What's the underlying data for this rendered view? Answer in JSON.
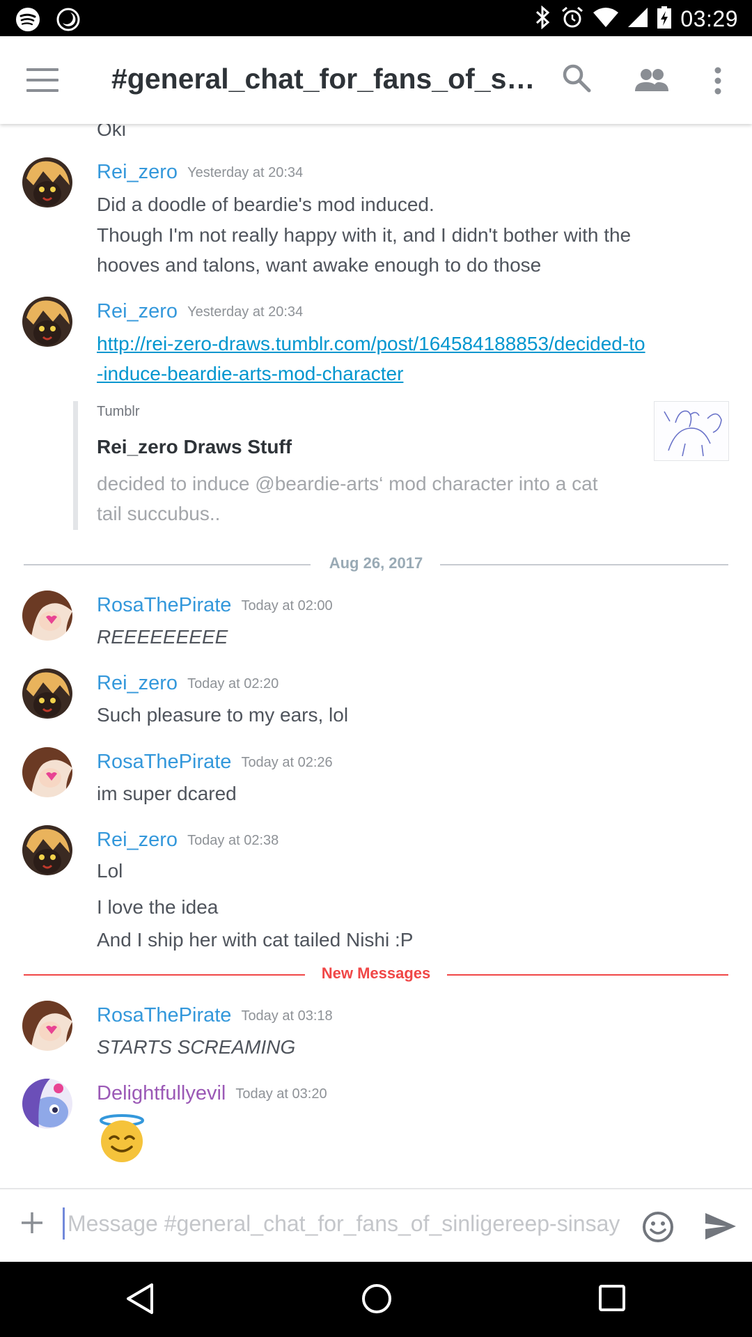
{
  "status_bar": {
    "time": "03:29",
    "icons": [
      "spotify-icon",
      "moon-icon",
      "bluetooth-icon",
      "alarm-icon",
      "wifi-icon",
      "signal-icon",
      "battery-charging-icon"
    ]
  },
  "toolbar": {
    "title": "#general_chat_for_fans_of_sinlig...",
    "icons": [
      "menu-icon",
      "search-icon",
      "members-icon",
      "overflow-menu-icon"
    ]
  },
  "chat": {
    "partial_line": "Oki",
    "messages": [
      {
        "author": "Rei_zero",
        "timestamp": "Yesterday at 20:34",
        "lines": [
          "Did a doodle of beardie's mod induced.",
          "Though I'm not really happy with it, and I didn't bother with the",
          "hooves and talons, want awake enough to do those"
        ]
      },
      {
        "author": "Rei_zero",
        "timestamp": "Yesterday at 20:34",
        "link_lines": [
          "http://rei-zero-draws.tumblr.com/post/164584188853/decided-to",
          "-induce-beardie-arts-mod-character"
        ],
        "embed": {
          "provider": "Tumblr",
          "title": "Rei_zero Draws Stuff",
          "description_lines": [
            "decided to induce @beardie-arts‘ mod character into a cat",
            "tail succubus.."
          ]
        }
      },
      {
        "author": "RosaThePirate",
        "timestamp": "Today at 02:00",
        "lines": [
          "REEEEEEEEE"
        ]
      },
      {
        "author": "Rei_zero",
        "timestamp": "Today at 02:20",
        "lines": [
          "Such pleasure to my ears, lol"
        ]
      },
      {
        "author": "RosaThePirate",
        "timestamp": "Today at 02:26",
        "lines": [
          "im super dcared"
        ]
      },
      {
        "author": "Rei_zero",
        "timestamp": "Today at 02:38",
        "lines": [
          "Lol",
          "I love the idea",
          "And I ship her with cat tailed Nishi :P"
        ]
      },
      {
        "author": "RosaThePirate",
        "timestamp": "Today at 03:18",
        "lines": [
          "STARTS SCREAMING"
        ]
      },
      {
        "author": "Delightfullyevil",
        "timestamp": "Today at 03:20",
        "emoji": "smiling-face-with-halo"
      }
    ],
    "date_divider": "Aug 26, 2017",
    "new_messages_divider": "New Messages"
  },
  "composer": {
    "placeholder": "Message #general_chat_for_fans_of_sinligereep-sinsays",
    "value": ""
  },
  "nav_bar": {
    "icons": [
      "back-icon",
      "home-icon",
      "recents-icon"
    ]
  },
  "colors": {
    "username": "#3498db",
    "username_delightfullyevil": "#9b59b6",
    "link": "#0096cf",
    "new_messages": "#f04747",
    "date_divider_line": "#b9bbbe",
    "composer_caret": "#7289da"
  }
}
